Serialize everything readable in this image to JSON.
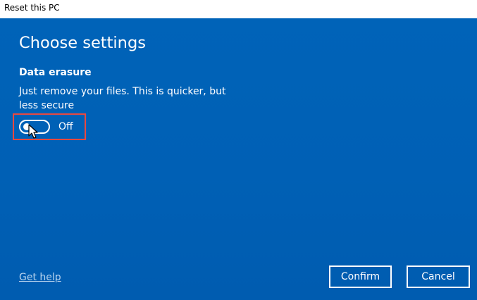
{
  "window": {
    "title": "Reset this PC"
  },
  "main": {
    "heading": "Choose settings",
    "data_erasure": {
      "label": "Data erasure",
      "description": "Just remove your files. This is quicker, but less secure",
      "toggle_state": "Off",
      "toggle_on": false
    },
    "help_link": "Get help"
  },
  "footer": {
    "confirm_label": "Confirm",
    "cancel_label": "Cancel"
  },
  "colors": {
    "panel_background": "#0063b8",
    "highlight_border": "#e8493f",
    "link": "#b8d4ee",
    "text": "#ffffff"
  },
  "icons": {
    "cursor": "mouse-pointer-icon"
  }
}
